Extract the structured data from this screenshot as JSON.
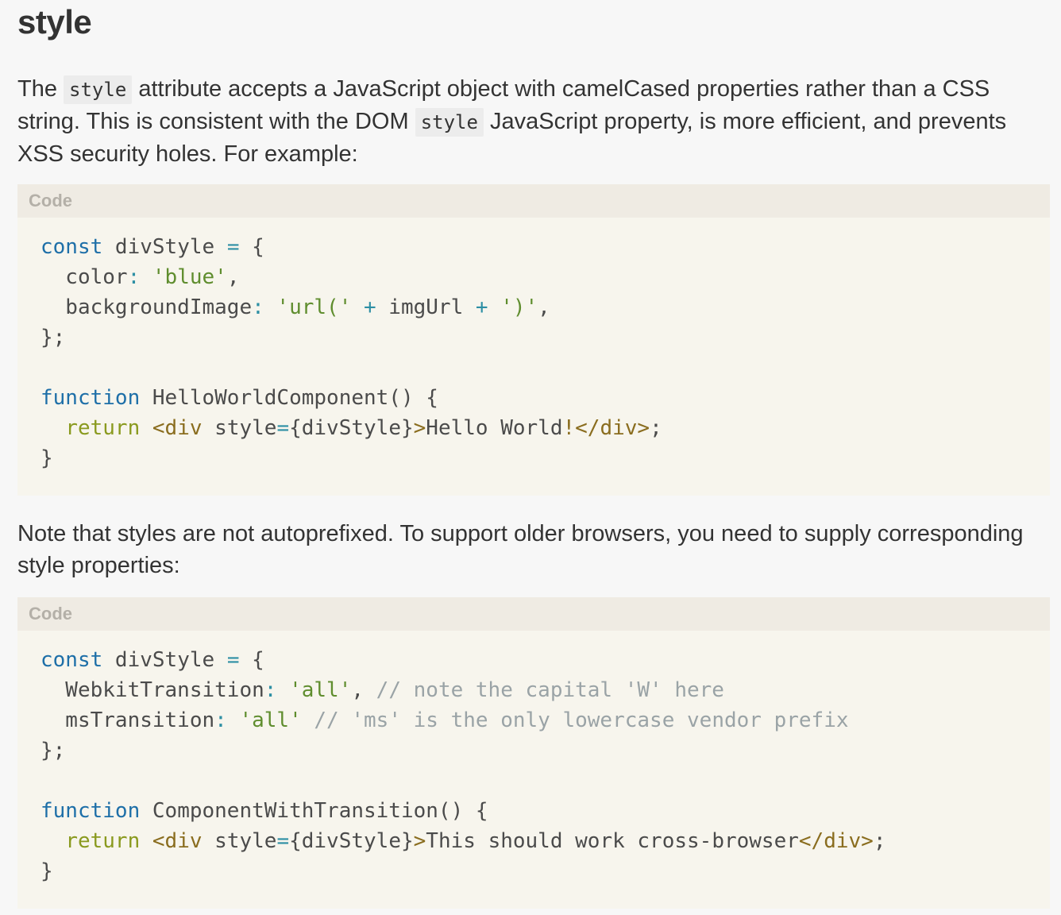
{
  "heading": "style",
  "para1": {
    "t1": "The ",
    "c1": "style",
    "t2": " attribute accepts a JavaScript object with camelCased properties rather than a CSS string. This is consistent with the DOM ",
    "c2": "style",
    "t3": " JavaScript property, is more efficient, and prevents XSS security holes. For example:"
  },
  "code1": {
    "label": "Code",
    "lines": [
      [
        [
          "kw",
          "const"
        ],
        [
          "txt",
          " divStyle "
        ],
        [
          "op",
          "="
        ],
        [
          "txt",
          " {"
        ]
      ],
      [
        [
          "prop",
          "  color"
        ],
        [
          "op",
          ":"
        ],
        [
          "txt",
          " "
        ],
        [
          "str",
          "'blue'"
        ],
        [
          "txt",
          ","
        ]
      ],
      [
        [
          "prop",
          "  backgroundImage"
        ],
        [
          "op",
          ":"
        ],
        [
          "txt",
          " "
        ],
        [
          "str",
          "'url('"
        ],
        [
          "txt",
          " "
        ],
        [
          "op",
          "+"
        ],
        [
          "txt",
          " imgUrl "
        ],
        [
          "op",
          "+"
        ],
        [
          "txt",
          " "
        ],
        [
          "str",
          "')'"
        ],
        [
          "txt",
          ","
        ]
      ],
      [
        [
          "txt",
          "};"
        ]
      ],
      [
        [
          "txt",
          ""
        ]
      ],
      [
        [
          "kw",
          "function"
        ],
        [
          "txt",
          " HelloWorldComponent() {"
        ]
      ],
      [
        [
          "txt",
          "  "
        ],
        [
          "ret",
          "return"
        ],
        [
          "txt",
          " "
        ],
        [
          "tag",
          "<div"
        ],
        [
          "txt",
          " style"
        ],
        [
          "op",
          "="
        ],
        [
          "txt",
          "{divStyle}"
        ],
        [
          "tag",
          ">"
        ],
        [
          "txt",
          "Hello World"
        ],
        [
          "tag",
          "!</div>"
        ],
        [
          "txt",
          ";"
        ]
      ],
      [
        [
          "txt",
          "}"
        ]
      ]
    ]
  },
  "para2": {
    "text": "Note that styles are not autoprefixed. To support older browsers, you need to supply corresponding style properties:"
  },
  "code2": {
    "label": "Code",
    "lines": [
      [
        [
          "kw",
          "const"
        ],
        [
          "txt",
          " divStyle "
        ],
        [
          "op",
          "="
        ],
        [
          "txt",
          " {"
        ]
      ],
      [
        [
          "prop",
          "  WebkitTransition"
        ],
        [
          "op",
          ":"
        ],
        [
          "txt",
          " "
        ],
        [
          "str",
          "'all'"
        ],
        [
          "txt",
          ", "
        ],
        [
          "cmt",
          "// note the capital 'W' here"
        ]
      ],
      [
        [
          "prop",
          "  msTransition"
        ],
        [
          "op",
          ":"
        ],
        [
          "txt",
          " "
        ],
        [
          "str",
          "'all'"
        ],
        [
          "txt",
          " "
        ],
        [
          "cmt",
          "// 'ms' is the only lowercase vendor prefix"
        ]
      ],
      [
        [
          "txt",
          "};"
        ]
      ],
      [
        [
          "txt",
          ""
        ]
      ],
      [
        [
          "kw",
          "function"
        ],
        [
          "txt",
          " ComponentWithTransition() {"
        ]
      ],
      [
        [
          "txt",
          "  "
        ],
        [
          "ret",
          "return"
        ],
        [
          "txt",
          " "
        ],
        [
          "tag",
          "<div"
        ],
        [
          "txt",
          " style"
        ],
        [
          "op",
          "="
        ],
        [
          "txt",
          "{divStyle}"
        ],
        [
          "tag",
          ">"
        ],
        [
          "txt",
          "This should work cross-browser"
        ],
        [
          "tag",
          "</div>"
        ],
        [
          "txt",
          ";"
        ]
      ],
      [
        [
          "txt",
          "}"
        ]
      ]
    ]
  }
}
